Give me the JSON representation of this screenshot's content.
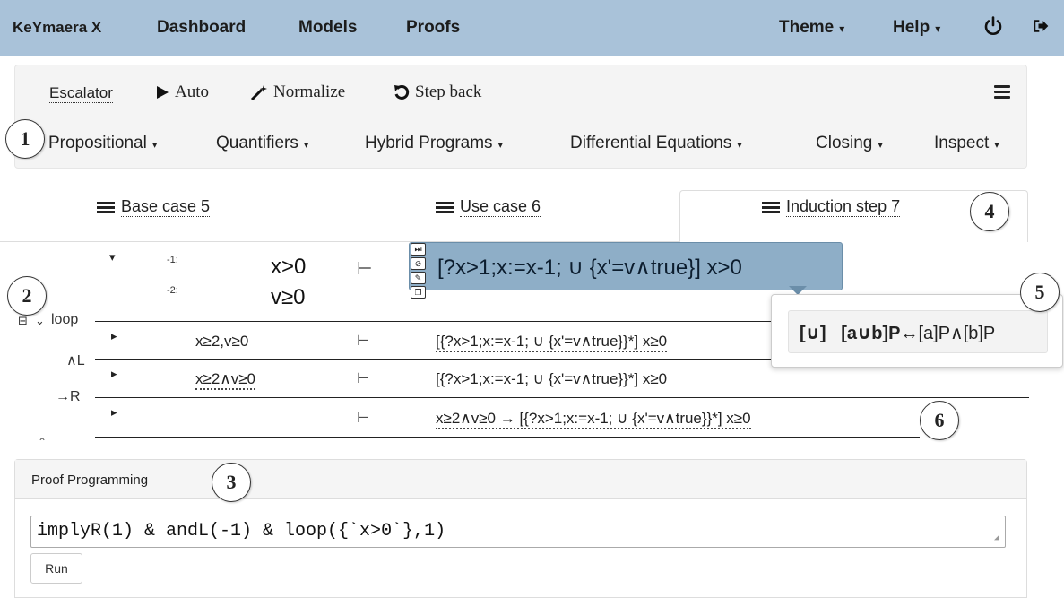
{
  "navbar": {
    "brand": "KeYmaera X",
    "dashboard": "Dashboard",
    "models": "Models",
    "proofs": "Proofs",
    "theme": "Theme",
    "help": "Help",
    "caret": "▾",
    "power_icon": "power-icon",
    "logout_icon": "logout-icon"
  },
  "toolbar": {
    "escalator": "Escalator",
    "auto": "Auto",
    "normalize": "Normalize",
    "step_back": "Step back",
    "menus": [
      "Propositional",
      "Quantifiers",
      "Hybrid Programs",
      "Differential Equations",
      "Closing",
      "Inspect"
    ]
  },
  "callouts": [
    "1",
    "2",
    "3",
    "4",
    "5",
    "6"
  ],
  "tabs": [
    {
      "label": "Base case 5"
    },
    {
      "label": "Use case 6"
    },
    {
      "label": "Induction step 7"
    }
  ],
  "sequent": {
    "ante": [
      {
        "num": "-1:",
        "formula": "x>0"
      },
      {
        "num": "-2:",
        "formula": "v≥0"
      }
    ],
    "turnstile": "⊢",
    "succedent": "[?x>1;x:=x-1;  ∪  {x'=v∧true}] x>0",
    "caret": "▾"
  },
  "history": [
    {
      "rule": "loop",
      "ante": "x≥2,v≥0",
      "succ": "[{?x>1;x:=x-1;  ∪  {x'=v∧true}}*] x≥0"
    },
    {
      "rule": "∧L",
      "ante": "x≥2∧v≥0",
      "succ": "[{?x>1;x:=x-1;  ∪  {x'=v∧true}}*] x≥0"
    },
    {
      "rule": "→R",
      "ante": "",
      "succ": "x≥2∧v≥0  →  [{?x>1;x:=x-1;  ∪  {x'=v∧true}}*] x≥0"
    }
  ],
  "history_controls": {
    "collapse": "⊟",
    "chevron": "⌄",
    "up": "⌃"
  },
  "popover": {
    "name": "[∪]",
    "lhs": "[a∪b]P",
    "rhs": "↔[a]P∧[b]P"
  },
  "proof_programming": {
    "title": "Proof Programming",
    "input_value": "implyR(1) & andL(-1) & loop({`x>0`},1)",
    "run_label": "Run"
  },
  "colors": {
    "navbar": "#a9c2d9",
    "highlight": "#8eaec7"
  }
}
